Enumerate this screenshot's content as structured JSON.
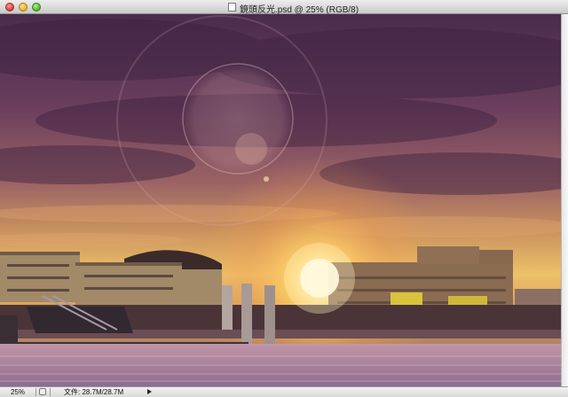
{
  "window": {
    "title": "鏡頭反光.psd @ 25% (RGB/8)"
  },
  "status_bar": {
    "zoom": "25%",
    "file_info": "文件: 28.7M/28.7M"
  },
  "colors": {
    "sky_top": "#51304f",
    "sky_mid": "#8b5c64",
    "sun_glow": "#ffd56a",
    "water": "#a07c96"
  }
}
